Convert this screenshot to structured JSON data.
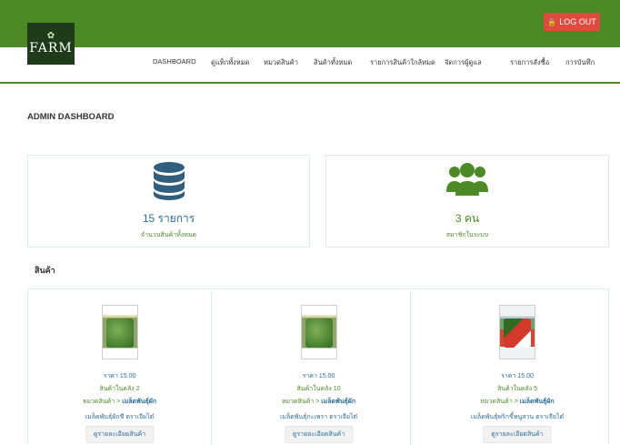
{
  "header": {
    "logout_label": "LOG OUT",
    "logo_text": "FARM",
    "logo_subtext": "FARM",
    "brand_color": "#4b8a24",
    "logout_color": "#e04b3f"
  },
  "nav": {
    "items": [
      {
        "label": "DASHBOARD"
      },
      {
        "label": "ดูแท็กทั้งหมด"
      },
      {
        "label": "หมวดสินค้า"
      },
      {
        "label": "สินค้าทั้งหมด"
      },
      {
        "label": "รายการสินค้าใกล้หมด"
      },
      {
        "label": "จัดการผู้ดูแล"
      },
      {
        "label": "รายการสั่งซื้อ"
      },
      {
        "label": "การบันทึก"
      }
    ]
  },
  "page": {
    "title": "ADMIN DASHBOARD"
  },
  "stats": [
    {
      "value": "15 รายการ",
      "label": "จำนวนสินค้าทั้งหมด",
      "icon": "database-icon"
    },
    {
      "value": "3 คน",
      "label": "สมาชิกในระบบ",
      "icon": "users-icon"
    }
  ],
  "products_section": {
    "title": "สินค้า",
    "items": [
      {
        "price": "ราคา 15.00",
        "stock": "สินค้าในคลัง 2",
        "category_prefix": "หมวดสินค้า > ",
        "category": "เมล็ดพันธุ์ผัก",
        "name": "เมล็ดพันธุ์ผักชี ตราเจียไต๋",
        "button": "ดูรายละเอียดสินค้า"
      },
      {
        "price": "ราคา 15.00",
        "stock": "สินค้าในคลัง 10",
        "category_prefix": "หมวดสินค้า > ",
        "category": "เมล็ดพันธุ์ผัก",
        "name": "เมล็ดพันธุ์กะเพรา ตราเจียไต๋",
        "button": "ดูรายละเอียดสินค้า"
      },
      {
        "price": "ราคา 15.00",
        "stock": "สินค้าในคลัง 5",
        "category_prefix": "หมวดสินค้า > ",
        "category": "เมล็ดพันธุ์ผัก",
        "name": "เมล็ดพันธุ์พริกขี้หนูสวน ตราเจียไต๋",
        "button": "ดูรายละเอียดสินค้า"
      }
    ]
  }
}
